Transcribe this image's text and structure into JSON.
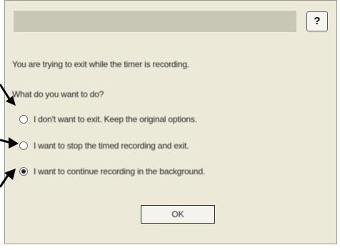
{
  "dialog": {
    "help_label": "?",
    "message": "You are trying to exit while the timer is recording.",
    "question": "What do you want to do?",
    "options": [
      {
        "label": "I don't want to exit. Keep the original options.",
        "checked": false
      },
      {
        "label": "I want to stop the timed recording and exit.",
        "checked": false
      },
      {
        "label": "I want to continue recording in the background.",
        "checked": true
      }
    ],
    "ok_label": "OK"
  },
  "colors": {
    "dialog_bg": "#ece9d8",
    "titlebar": "#c8c6b5",
    "arrow": "#000000"
  },
  "annotations": {
    "arrow_count": 3,
    "arrow_icon": "black-arrow-pointer"
  }
}
